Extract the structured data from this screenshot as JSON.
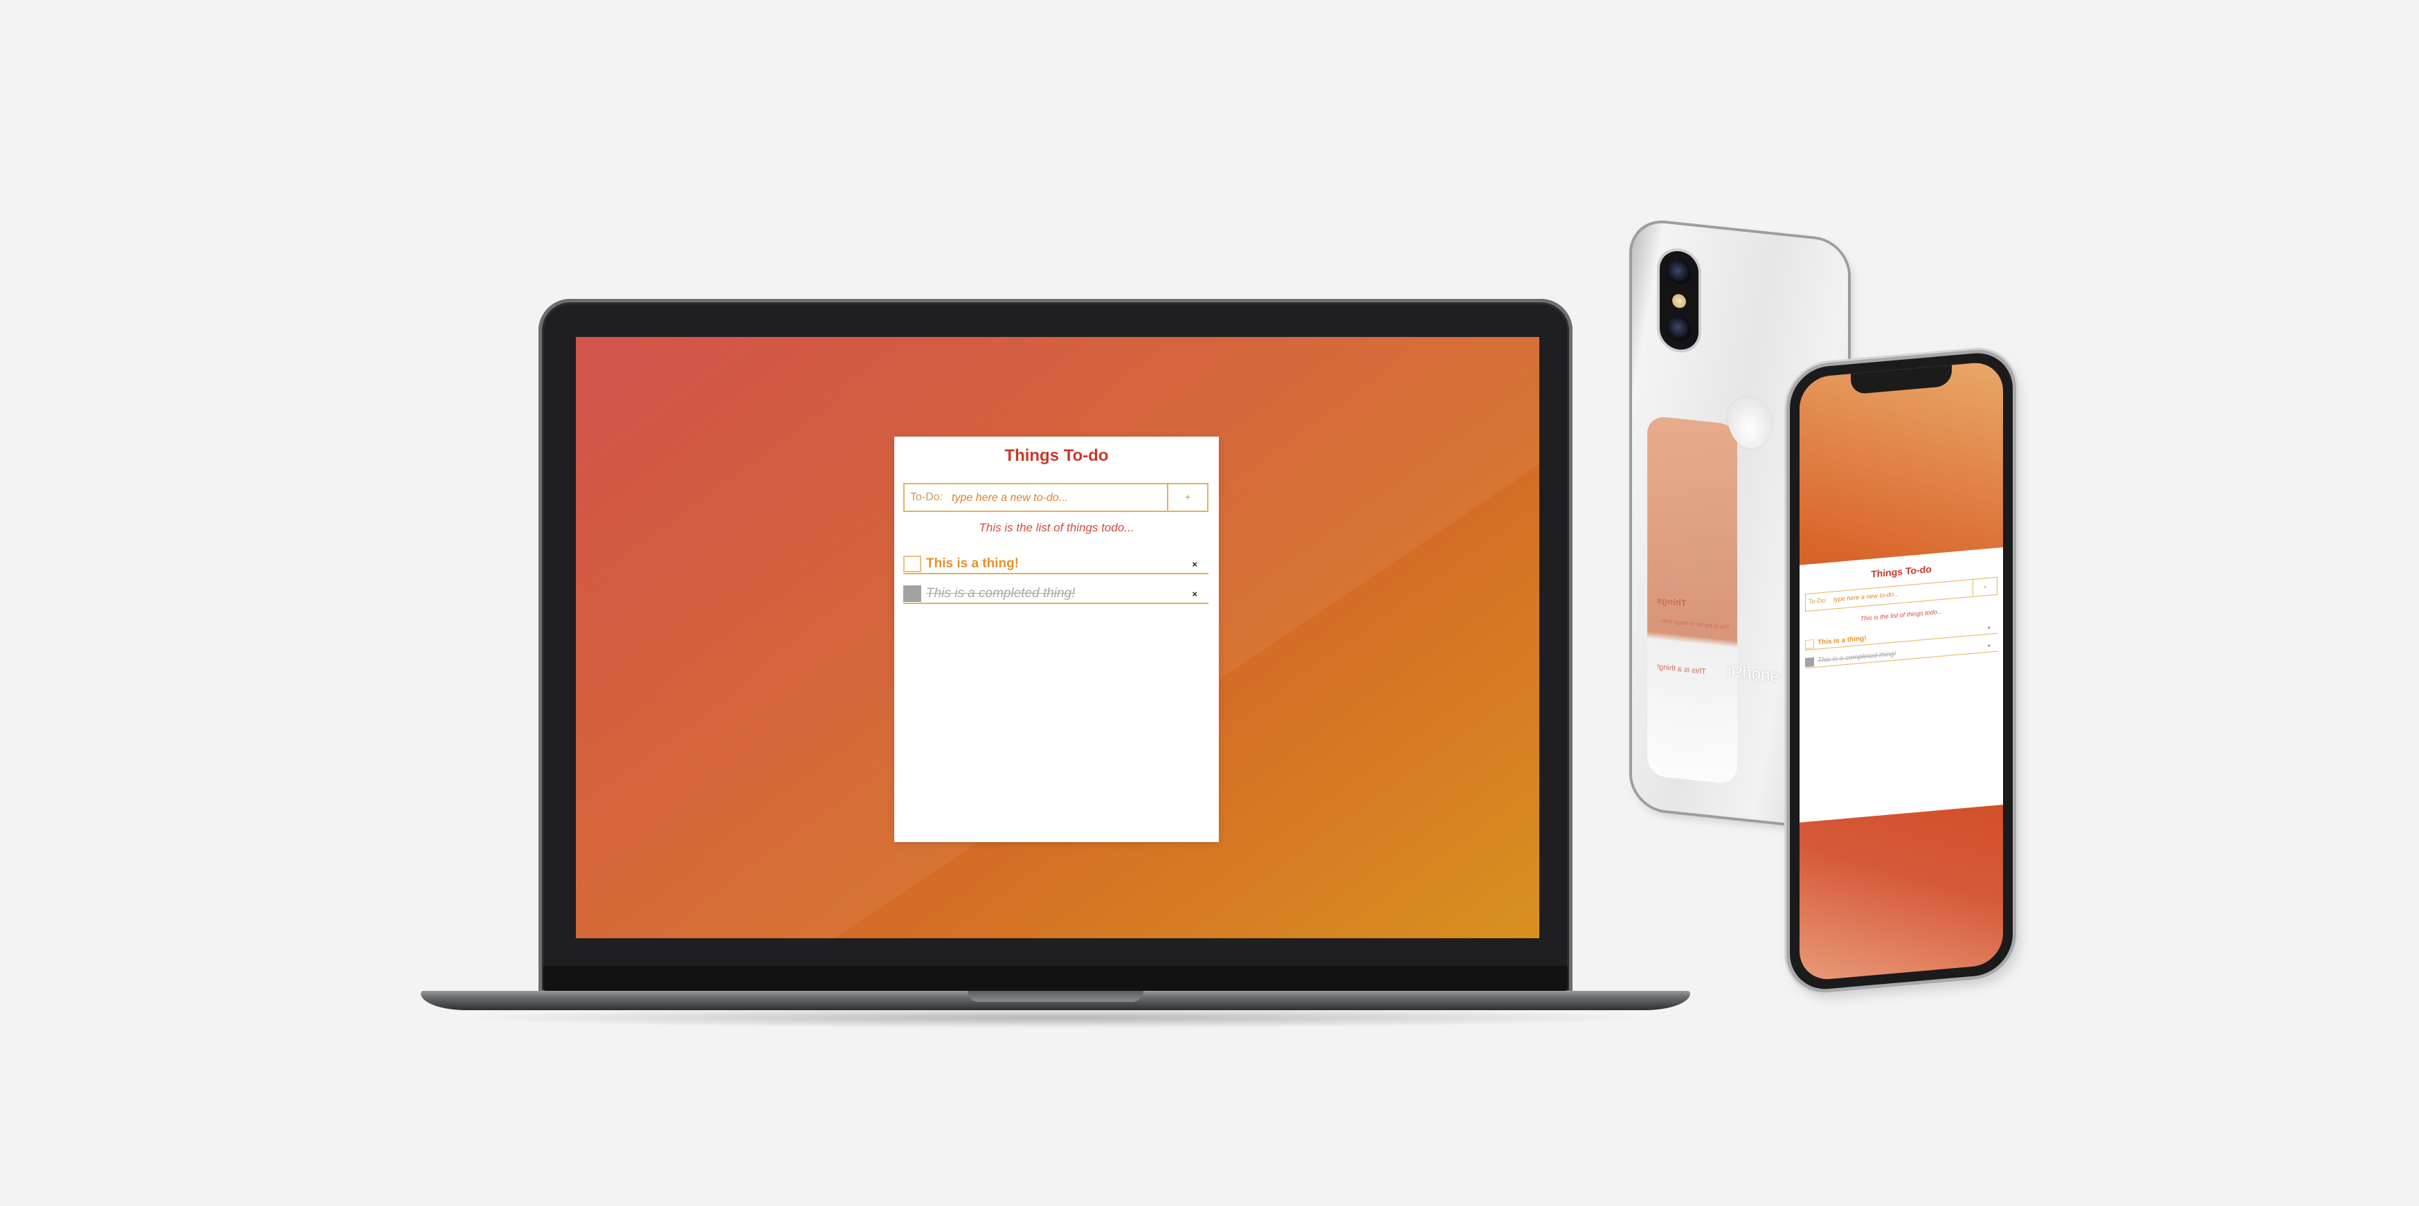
{
  "app": {
    "title": "Things To-do",
    "input_label": "To-Do:",
    "input_placeholder": "type here a new to-do...",
    "add_button": "+",
    "subtitle": "This is the list of things todo...",
    "items": [
      {
        "text": "This is a thing!",
        "completed": false,
        "delete": "×"
      },
      {
        "text": "This is a completed thing!",
        "completed": true,
        "delete": "×"
      }
    ]
  },
  "devices": {
    "phone_back_label": "iPhone",
    "back_reflection": {
      "title_mirrored": "Things",
      "line1": "This is the list of things todo...",
      "line2": "This is a thing!"
    }
  },
  "colors": {
    "background": "#f3f3f3",
    "accent_red": "#c9382a",
    "accent_orange": "#e4912a",
    "border_gold": "#e2b35a",
    "completed_grey": "#a2a2a2"
  }
}
